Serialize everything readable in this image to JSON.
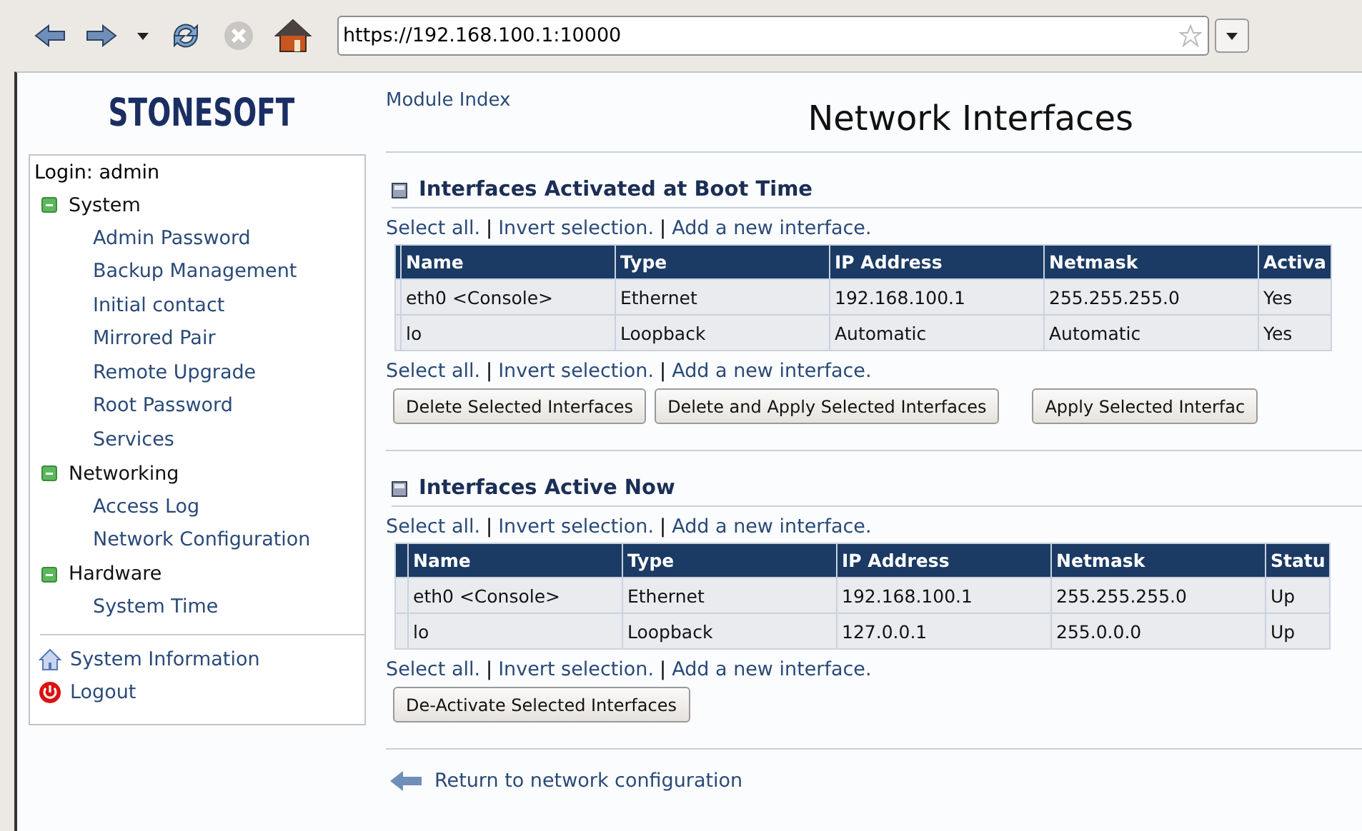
{
  "browser": {
    "url": "https://192.168.100.1:10000",
    "stop_disabled": true
  },
  "sidebar": {
    "brand": "STONESOFT",
    "login": "Login: admin",
    "groups": [
      {
        "label": "System",
        "expanded": true,
        "items": [
          "Admin Password",
          "Backup Management",
          "Initial contact",
          "Mirrored Pair",
          "Remote Upgrade",
          "Root Password",
          "Services"
        ]
      },
      {
        "label": "Networking",
        "expanded": true,
        "items": [
          "Access Log",
          "Network Configuration"
        ]
      },
      {
        "label": "Hardware",
        "expanded": true,
        "items": [
          "System Time"
        ]
      }
    ],
    "footer_links": [
      {
        "kind": "info",
        "label": "System Information"
      },
      {
        "kind": "logout",
        "label": "Logout"
      }
    ]
  },
  "main": {
    "module_link": "Module Index",
    "title": "Network Interfaces",
    "sections": [
      {
        "title": "Interfaces Activated at Boot Time",
        "links_top": [
          "Select all.",
          "Invert selection.",
          "Add a new interface."
        ],
        "links_bottom": [
          "Select all.",
          "Invert selection.",
          "Add a new interface."
        ],
        "separator": "|",
        "columns": [
          "Name",
          "Type",
          "IP Address",
          "Netmask",
          "Activa"
        ],
        "rows": [
          [
            "eth0 <Console>",
            "Ethernet",
            "192.168.100.1",
            "255.255.255.0",
            "Yes"
          ],
          [
            "lo",
            "Loopback",
            "Automatic",
            "Automatic",
            "Yes"
          ]
        ],
        "buttons": [
          "Delete Selected Interfaces",
          "Delete and Apply Selected Interfaces",
          "Apply Selected Interfac"
        ]
      },
      {
        "title": "Interfaces Active Now",
        "links_top": [
          "Select all.",
          "Invert selection.",
          "Add a new interface."
        ],
        "links_bottom": [
          "Select all.",
          "Invert selection.",
          "Add a new interface."
        ],
        "separator": "|",
        "columns": [
          "Name",
          "Type",
          "IP Address",
          "Netmask",
          "Statu"
        ],
        "rows": [
          [
            "eth0 <Console>",
            "Ethernet",
            "192.168.100.1",
            "255.255.255.0",
            "Up"
          ],
          [
            "lo",
            "Loopback",
            "127.0.0.1",
            "255.0.0.0",
            "Up"
          ]
        ],
        "buttons": [
          "De-Activate Selected Interfaces"
        ]
      }
    ],
    "return_link": "Return to network configuration"
  }
}
